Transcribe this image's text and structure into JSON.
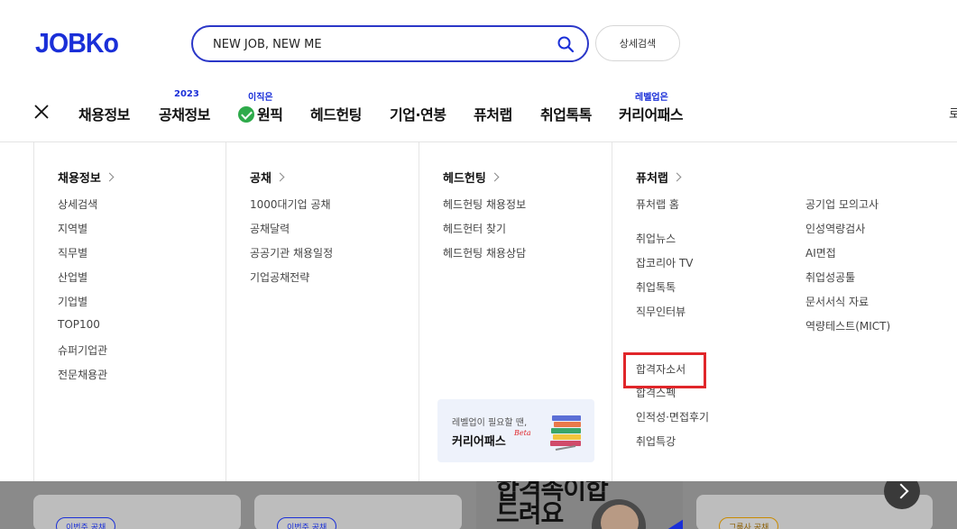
{
  "header": {
    "logo": "JOBKo",
    "search_placeholder": "NEW JOB, NEW ME",
    "advanced_search": "상세검색"
  },
  "nav": {
    "items": [
      {
        "label": "채용정보",
        "badge": ""
      },
      {
        "label": "공채정보",
        "badge": "2023"
      },
      {
        "label": "원픽",
        "badge": "이직은"
      },
      {
        "label": "헤드헌팅",
        "badge": ""
      },
      {
        "label": "기업·연봉",
        "badge": ""
      },
      {
        "label": "퓨처랩",
        "badge": ""
      },
      {
        "label": "취업톡톡",
        "badge": ""
      },
      {
        "label": "커리어패스",
        "badge": "레벨업은"
      }
    ],
    "edge_char": "로"
  },
  "menu": {
    "col1": {
      "title": "채용정보",
      "links": [
        "상세검색",
        "지역별",
        "직무별",
        "산업별",
        "기업별",
        "TOP100",
        "슈퍼기업관",
        "전문채용관"
      ]
    },
    "col2": {
      "title": "공채",
      "links": [
        "1000대기업 공채",
        "공채달력",
        "공공기관 채용일정",
        "기업공채전략"
      ]
    },
    "col3": {
      "title": "헤드헌팅",
      "links": [
        "헤드헌팅 채용정보",
        "헤드헌터 찾기",
        "헤드헌팅 채용상담"
      ]
    },
    "col4": {
      "title": "퓨처랩",
      "links_a": [
        "퓨처랩 홈"
      ],
      "links_b": [
        "취업뉴스",
        "잡코리아 TV",
        "취업톡톡",
        "직무인터뷰"
      ],
      "links_c": [
        "합격자소서",
        "합격스펙",
        "인적성·면접후기",
        "취업특강"
      ]
    },
    "col5": {
      "links": [
        "공기업 모의고사",
        "인성역량검사",
        "AI면접",
        "취업성공툴",
        "문서서식 자료",
        "역량테스트(MICT)"
      ]
    },
    "promo": {
      "line1": "레벨업이 필요할 땐,",
      "line2": "커리어패스",
      "beta": "Beta"
    }
  },
  "background": {
    "pill1": "이번주 공채",
    "pill2": "이번주 공채",
    "pill3": "그룹사 공채",
    "banner_line1": "합격족이합",
    "banner_line2": "드려요"
  },
  "colors": {
    "brand": "#1a2fd8",
    "highlight": "#e0262a"
  }
}
